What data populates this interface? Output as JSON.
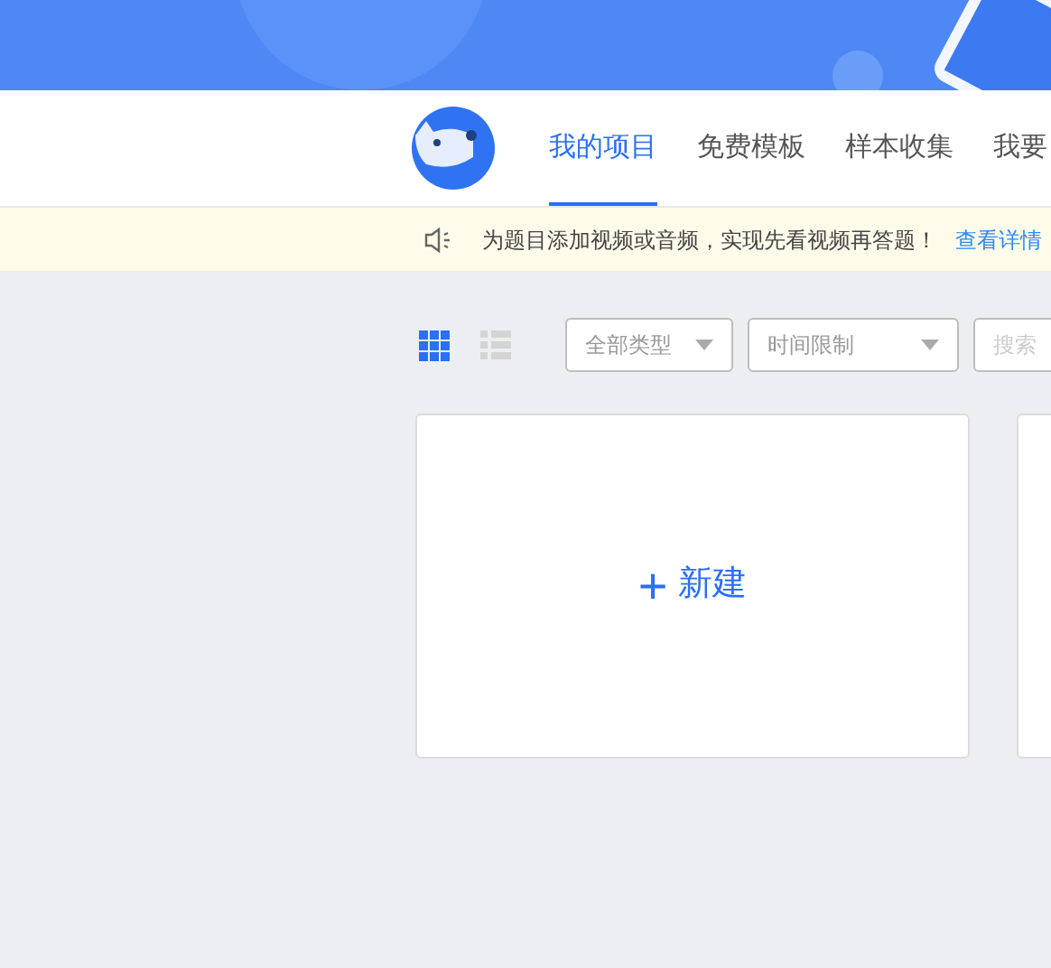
{
  "nav": {
    "tabs": [
      {
        "label": "我的项目",
        "selected": true
      },
      {
        "label": "免费模板",
        "selected": false
      },
      {
        "label": "样本收集",
        "selected": false
      },
      {
        "label": "我要",
        "selected": false
      }
    ]
  },
  "notice": {
    "text": "为题目添加视频或音频，实现先看视频再答题！",
    "link": "查看详情"
  },
  "toolbar": {
    "views": [
      {
        "kind": "grid",
        "selected": true
      },
      {
        "kind": "list",
        "selected": false
      }
    ],
    "filters": [
      {
        "placeholder": "全部类型"
      },
      {
        "placeholder": "时间限制"
      }
    ],
    "search": {
      "placeholder": "搜索"
    }
  },
  "cards": [
    {
      "kind": "new",
      "label": "新建",
      "symbol": "+"
    },
    {
      "kind": "blank"
    }
  ]
}
